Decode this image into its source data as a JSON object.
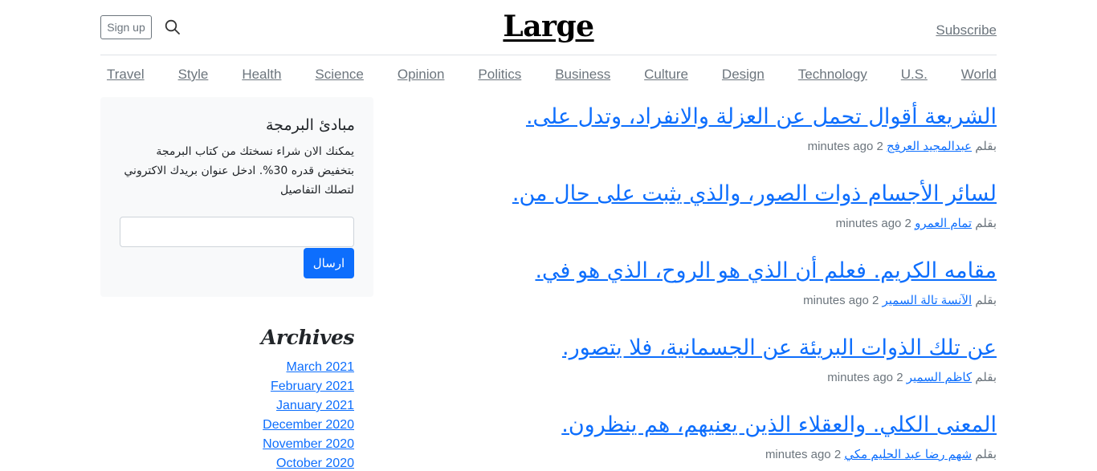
{
  "header": {
    "signup_label": "Sign up",
    "logo": "Large",
    "subscribe_label": "Subscribe"
  },
  "nav": {
    "items": [
      "Travel",
      "Style",
      "Health",
      "Science",
      "Opinion",
      "Politics",
      "Business",
      "Culture",
      "Design",
      "Technology",
      "U.S.",
      "World"
    ]
  },
  "widget": {
    "title": "مبادئ البرمجة",
    "text": "يمكنك الان شراء نسختك من كتاب البرمجة بتخفيض قدره 30%. ادخل عنوان بريدك الاكتروني لتصلك التفاصيل",
    "input_placeholder": "",
    "button_label": "ارسال"
  },
  "archives": {
    "title": "Archives",
    "items": [
      "March 2021",
      "February 2021",
      "January 2021",
      "December 2020",
      "November 2020",
      "October 2020"
    ]
  },
  "posts": [
    {
      "title": "الشريعة أقوال تحمل عن العزلة والانفراد، وتدل على.",
      "by": "بقلم",
      "author": "عبدالمجيد العرفج",
      "time": "2 minutes ago"
    },
    {
      "title": "لسائر الأجسام ذوات الصور، والذي يثبت على حال من.",
      "by": "بقلم",
      "author": "تمام العمرو",
      "time": "2 minutes ago"
    },
    {
      "title": "مقامه الكريم. فعلم أن الذي هو الروح، الذي هو في.",
      "by": "بقلم",
      "author": "الآنسة تالة السمير",
      "time": "2 minutes ago"
    },
    {
      "title": "عن تلك الذوات البريئة عن الجسمانية، فلا يتصور.",
      "by": "بقلم",
      "author": "كاظم السمير",
      "time": "2 minutes ago"
    },
    {
      "title": "المعنى الكلي. والعقلاء الذين يعنيهم، هم ينظرون.",
      "by": "بقلم",
      "author": "شهم رضا عبد الحليم مكي",
      "time": "2 minutes ago"
    }
  ],
  "colors": {
    "link": "#0d6efd",
    "muted": "#6c757d",
    "panel": "#f8f9fa"
  }
}
